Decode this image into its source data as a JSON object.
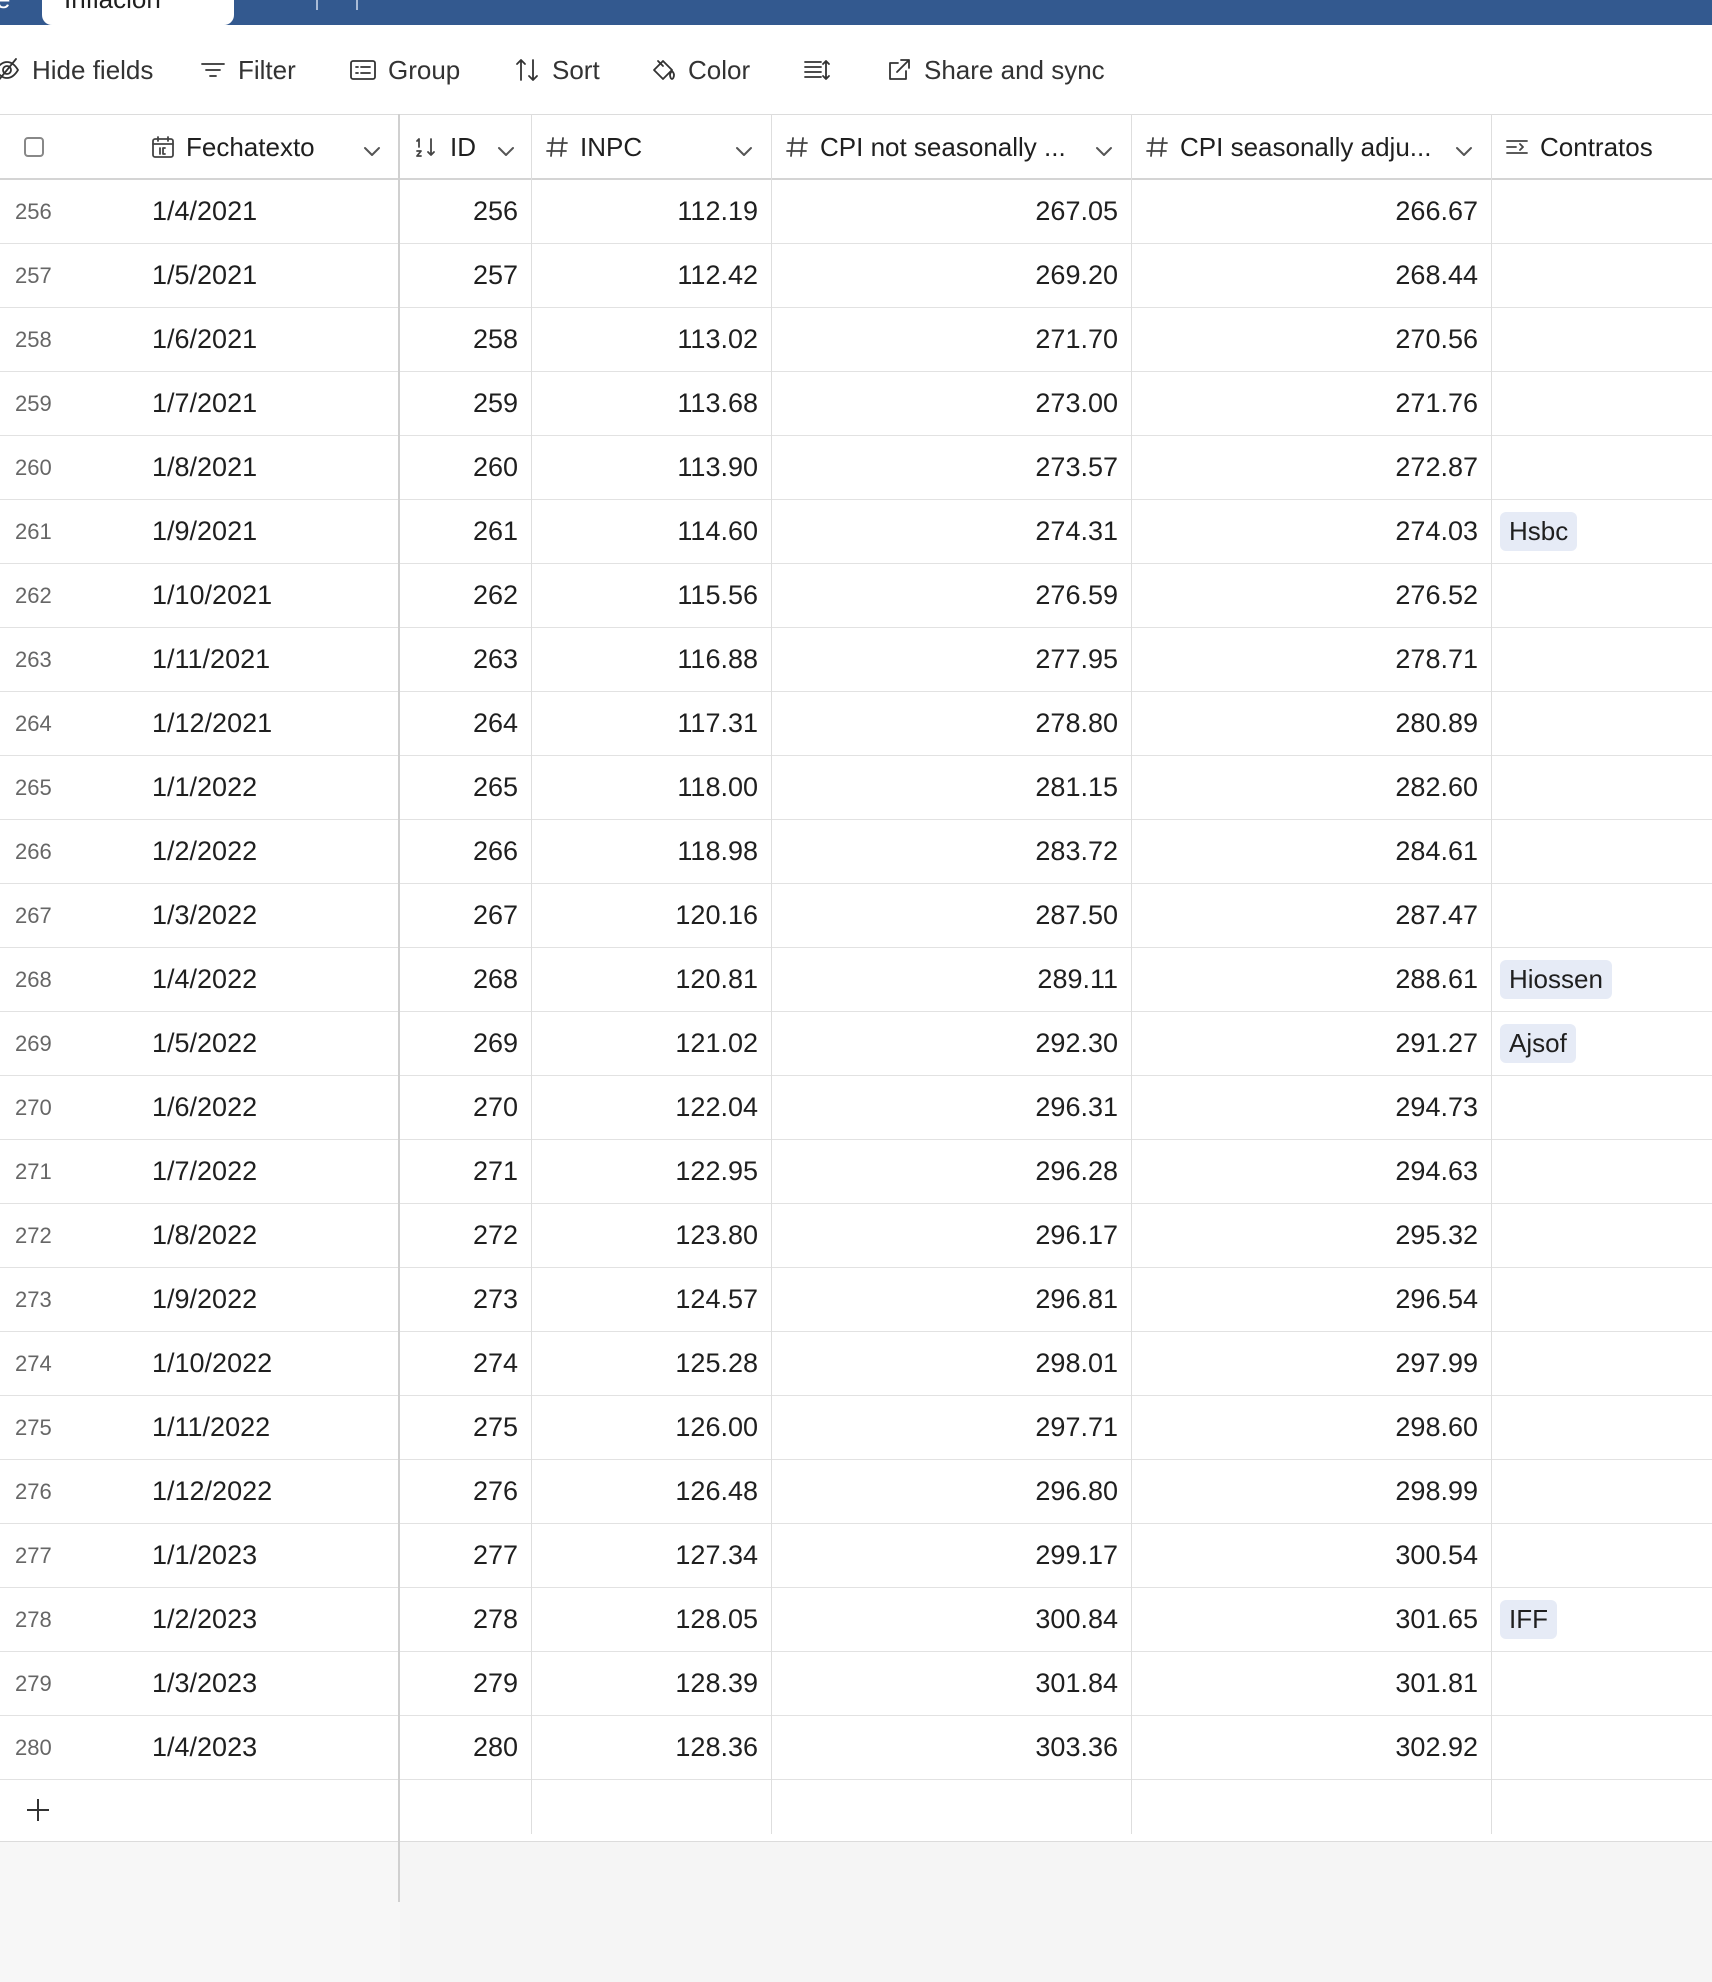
{
  "tabs": {
    "previous_partial": "e",
    "active_label": "Inflación"
  },
  "toolbar": {
    "hide_fields": "Hide fields",
    "filter": "Filter",
    "group": "Group",
    "sort": "Sort",
    "color": "Color",
    "share_sync": "Share and sync"
  },
  "columns": {
    "fechatexto": "Fechatexto",
    "id": "ID",
    "inpc": "INPC",
    "cpi_nsa": "CPI not seasonally ...",
    "cpi_sa": "CPI seasonally adju...",
    "contratos": "Contratos"
  },
  "rows": [
    {
      "num": "256",
      "date": "1/4/2021",
      "id": "256",
      "inpc": "112.19",
      "cpi_nsa": "267.05",
      "cpi_sa": "266.67",
      "contrato": ""
    },
    {
      "num": "257",
      "date": "1/5/2021",
      "id": "257",
      "inpc": "112.42",
      "cpi_nsa": "269.20",
      "cpi_sa": "268.44",
      "contrato": ""
    },
    {
      "num": "258",
      "date": "1/6/2021",
      "id": "258",
      "inpc": "113.02",
      "cpi_nsa": "271.70",
      "cpi_sa": "270.56",
      "contrato": ""
    },
    {
      "num": "259",
      "date": "1/7/2021",
      "id": "259",
      "inpc": "113.68",
      "cpi_nsa": "273.00",
      "cpi_sa": "271.76",
      "contrato": ""
    },
    {
      "num": "260",
      "date": "1/8/2021",
      "id": "260",
      "inpc": "113.90",
      "cpi_nsa": "273.57",
      "cpi_sa": "272.87",
      "contrato": ""
    },
    {
      "num": "261",
      "date": "1/9/2021",
      "id": "261",
      "inpc": "114.60",
      "cpi_nsa": "274.31",
      "cpi_sa": "274.03",
      "contrato": "Hsbc"
    },
    {
      "num": "262",
      "date": "1/10/2021",
      "id": "262",
      "inpc": "115.56",
      "cpi_nsa": "276.59",
      "cpi_sa": "276.52",
      "contrato": ""
    },
    {
      "num": "263",
      "date": "1/11/2021",
      "id": "263",
      "inpc": "116.88",
      "cpi_nsa": "277.95",
      "cpi_sa": "278.71",
      "contrato": ""
    },
    {
      "num": "264",
      "date": "1/12/2021",
      "id": "264",
      "inpc": "117.31",
      "cpi_nsa": "278.80",
      "cpi_sa": "280.89",
      "contrato": ""
    },
    {
      "num": "265",
      "date": "1/1/2022",
      "id": "265",
      "inpc": "118.00",
      "cpi_nsa": "281.15",
      "cpi_sa": "282.60",
      "contrato": ""
    },
    {
      "num": "266",
      "date": "1/2/2022",
      "id": "266",
      "inpc": "118.98",
      "cpi_nsa": "283.72",
      "cpi_sa": "284.61",
      "contrato": ""
    },
    {
      "num": "267",
      "date": "1/3/2022",
      "id": "267",
      "inpc": "120.16",
      "cpi_nsa": "287.50",
      "cpi_sa": "287.47",
      "contrato": ""
    },
    {
      "num": "268",
      "date": "1/4/2022",
      "id": "268",
      "inpc": "120.81",
      "cpi_nsa": "289.11",
      "cpi_sa": "288.61",
      "contrato": "Hiossen"
    },
    {
      "num": "269",
      "date": "1/5/2022",
      "id": "269",
      "inpc": "121.02",
      "cpi_nsa": "292.30",
      "cpi_sa": "291.27",
      "contrato": "Ajsof"
    },
    {
      "num": "270",
      "date": "1/6/2022",
      "id": "270",
      "inpc": "122.04",
      "cpi_nsa": "296.31",
      "cpi_sa": "294.73",
      "contrato": ""
    },
    {
      "num": "271",
      "date": "1/7/2022",
      "id": "271",
      "inpc": "122.95",
      "cpi_nsa": "296.28",
      "cpi_sa": "294.63",
      "contrato": ""
    },
    {
      "num": "272",
      "date": "1/8/2022",
      "id": "272",
      "inpc": "123.80",
      "cpi_nsa": "296.17",
      "cpi_sa": "295.32",
      "contrato": ""
    },
    {
      "num": "273",
      "date": "1/9/2022",
      "id": "273",
      "inpc": "124.57",
      "cpi_nsa": "296.81",
      "cpi_sa": "296.54",
      "contrato": ""
    },
    {
      "num": "274",
      "date": "1/10/2022",
      "id": "274",
      "inpc": "125.28",
      "cpi_nsa": "298.01",
      "cpi_sa": "297.99",
      "contrato": ""
    },
    {
      "num": "275",
      "date": "1/11/2022",
      "id": "275",
      "inpc": "126.00",
      "cpi_nsa": "297.71",
      "cpi_sa": "298.60",
      "contrato": ""
    },
    {
      "num": "276",
      "date": "1/12/2022",
      "id": "276",
      "inpc": "126.48",
      "cpi_nsa": "296.80",
      "cpi_sa": "298.99",
      "contrato": ""
    },
    {
      "num": "277",
      "date": "1/1/2023",
      "id": "277",
      "inpc": "127.34",
      "cpi_nsa": "299.17",
      "cpi_sa": "300.54",
      "contrato": ""
    },
    {
      "num": "278",
      "date": "1/2/2023",
      "id": "278",
      "inpc": "128.05",
      "cpi_nsa": "300.84",
      "cpi_sa": "301.65",
      "contrato": "IFF"
    },
    {
      "num": "279",
      "date": "1/3/2023",
      "id": "279",
      "inpc": "128.39",
      "cpi_nsa": "301.84",
      "cpi_sa": "301.81",
      "contrato": ""
    },
    {
      "num": "280",
      "date": "1/4/2023",
      "id": "280",
      "inpc": "128.36",
      "cpi_nsa": "303.36",
      "cpi_sa": "302.92",
      "contrato": ""
    }
  ],
  "colors": {
    "header_bar": "#33598f",
    "chip_bg": "#e6ebf6"
  }
}
